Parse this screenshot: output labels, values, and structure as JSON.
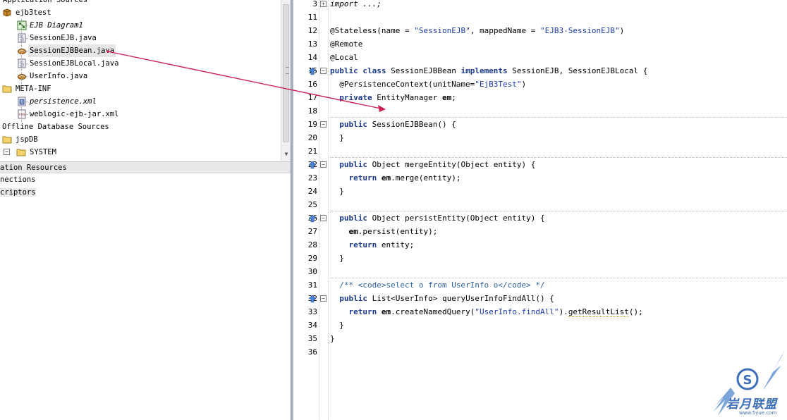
{
  "navigator": {
    "tree": [
      {
        "label": "Application Sources",
        "icon": "none",
        "italic": false,
        "selected": false
      },
      {
        "label": "ejb3test",
        "icon": "package-icon",
        "italic": false,
        "selected": false
      },
      {
        "label": "EJB Diagram1",
        "icon": "diagram-icon",
        "italic": true,
        "selected": false
      },
      {
        "label": "SessionEJB.java",
        "icon": "interface-file-icon",
        "italic": false,
        "selected": false
      },
      {
        "label": "SessionEJBBean.java",
        "icon": "bean-file-icon",
        "italic": false,
        "selected": true
      },
      {
        "label": "SessionEJBLocal.java",
        "icon": "interface-file-icon",
        "italic": false,
        "selected": false
      },
      {
        "label": "UserInfo.java",
        "icon": "bean-file-icon",
        "italic": false,
        "selected": false
      },
      {
        "label": "META-INF",
        "icon": "folder-icon",
        "italic": false,
        "selected": false
      },
      {
        "label": "persistence.xml",
        "icon": "persistence-file-icon",
        "italic": true,
        "selected": false
      },
      {
        "label": "weblogic-ejb-jar.xml",
        "icon": "xml-file-icon",
        "italic": false,
        "selected": false
      },
      {
        "label": "Offline Database Sources",
        "icon": "none",
        "italic": false,
        "selected": false
      },
      {
        "label": "jspDB",
        "icon": "folder-icon",
        "italic": false,
        "selected": false
      },
      {
        "label": "SYSTEM",
        "icon": "folder-icon",
        "italic": false,
        "selected": false
      }
    ],
    "sections": {
      "app_resources": "ation Resources",
      "connections": "nections",
      "descriptors": "criptors"
    }
  },
  "editor": {
    "lines": [
      {
        "n": "3",
        "fold": "plus",
        "marker": false,
        "sep": false,
        "html": "<span style=\"font-style:italic\">import ...;</span>"
      },
      {
        "n": "11",
        "fold": "",
        "marker": false,
        "sep": false,
        "html": ""
      },
      {
        "n": "12",
        "fold": "",
        "marker": false,
        "sep": false,
        "html": "@Stateless(name = <span class=\"str\">\"SessionEJB\"</span>, mappedName = <span class=\"str\">\"EJB3-SessionEJB\"</span>)"
      },
      {
        "n": "13",
        "fold": "",
        "marker": false,
        "sep": false,
        "html": "@Remote"
      },
      {
        "n": "14",
        "fold": "",
        "marker": false,
        "sep": false,
        "html": "@Local"
      },
      {
        "n": "15",
        "fold": "minus",
        "marker": true,
        "sep": false,
        "html": "<span class=\"kw\">public class</span> SessionEJBBean <span class=\"kw\">implements</span> SessionEJB, SessionEJBLocal {"
      },
      {
        "n": "16",
        "fold": "",
        "marker": false,
        "sep": false,
        "html": "  @PersistenceContext(unitName=<span class=\"str\">\"EjB3Test\"</span>)"
      },
      {
        "n": "17",
        "fold": "",
        "marker": false,
        "sep": false,
        "html": "  <span class=\"kw\">private</span> EntityManager <span class=\"fld\">em</span>;"
      },
      {
        "n": "18",
        "fold": "",
        "marker": false,
        "sep": true,
        "html": ""
      },
      {
        "n": "19",
        "fold": "minus",
        "marker": false,
        "sep": false,
        "html": "  <span class=\"kw\">public</span> SessionEJBBean() {"
      },
      {
        "n": "20",
        "fold": "",
        "marker": false,
        "sep": false,
        "html": "  }"
      },
      {
        "n": "21",
        "fold": "",
        "marker": false,
        "sep": true,
        "html": ""
      },
      {
        "n": "22",
        "fold": "minus",
        "marker": true,
        "sep": false,
        "html": "  <span class=\"kw\">public</span> Object mergeEntity(Object entity) {"
      },
      {
        "n": "23",
        "fold": "",
        "marker": false,
        "sep": false,
        "html": "    <span class=\"kw\">return</span> <span class=\"fld\">em</span>.merge(entity);"
      },
      {
        "n": "24",
        "fold": "",
        "marker": false,
        "sep": false,
        "html": "  }"
      },
      {
        "n": "25",
        "fold": "",
        "marker": false,
        "sep": true,
        "html": ""
      },
      {
        "n": "26",
        "fold": "minus",
        "marker": true,
        "sep": false,
        "html": "  <span class=\"kw\">public</span> Object persistEntity(Object entity) {"
      },
      {
        "n": "27",
        "fold": "",
        "marker": false,
        "sep": false,
        "html": "    <span class=\"fld\">em</span>.persist(entity);"
      },
      {
        "n": "28",
        "fold": "",
        "marker": false,
        "sep": false,
        "html": "    <span class=\"kw\">return</span> entity;"
      },
      {
        "n": "29",
        "fold": "",
        "marker": false,
        "sep": false,
        "html": "  }"
      },
      {
        "n": "30",
        "fold": "",
        "marker": false,
        "sep": true,
        "html": ""
      },
      {
        "n": "31",
        "fold": "",
        "marker": false,
        "sep": false,
        "html": "  <span class=\"cmt\">/** &lt;code&gt;select o from UserInfo o&lt;/code&gt; */</span>"
      },
      {
        "n": "32",
        "fold": "minus",
        "marker": true,
        "sep": false,
        "html": "  <span class=\"kw\">public</span> List&lt;UserInfo&gt; queryUserInfoFindAll() {"
      },
      {
        "n": "33",
        "fold": "",
        "marker": false,
        "sep": false,
        "html": "    <span class=\"kw\">return</span> <span class=\"fld\">em</span>.createNamedQuery(<span class=\"str\">\"UserInfo.findAll\"</span>).<span class=\"squig\">getResultList</span>();"
      },
      {
        "n": "34",
        "fold": "",
        "marker": false,
        "sep": false,
        "html": "  }"
      },
      {
        "n": "35",
        "fold": "",
        "marker": false,
        "sep": false,
        "html": "}"
      },
      {
        "n": "36",
        "fold": "",
        "marker": false,
        "sep": false,
        "html": ""
      }
    ]
  },
  "watermark": {
    "text": "岩月联盟",
    "url": "www.5yue.com"
  },
  "colors": {
    "arrow": "#cc2255",
    "keyword": "#1c3a8c",
    "string": "#1c3aa8",
    "marker": "#4a86d8"
  }
}
